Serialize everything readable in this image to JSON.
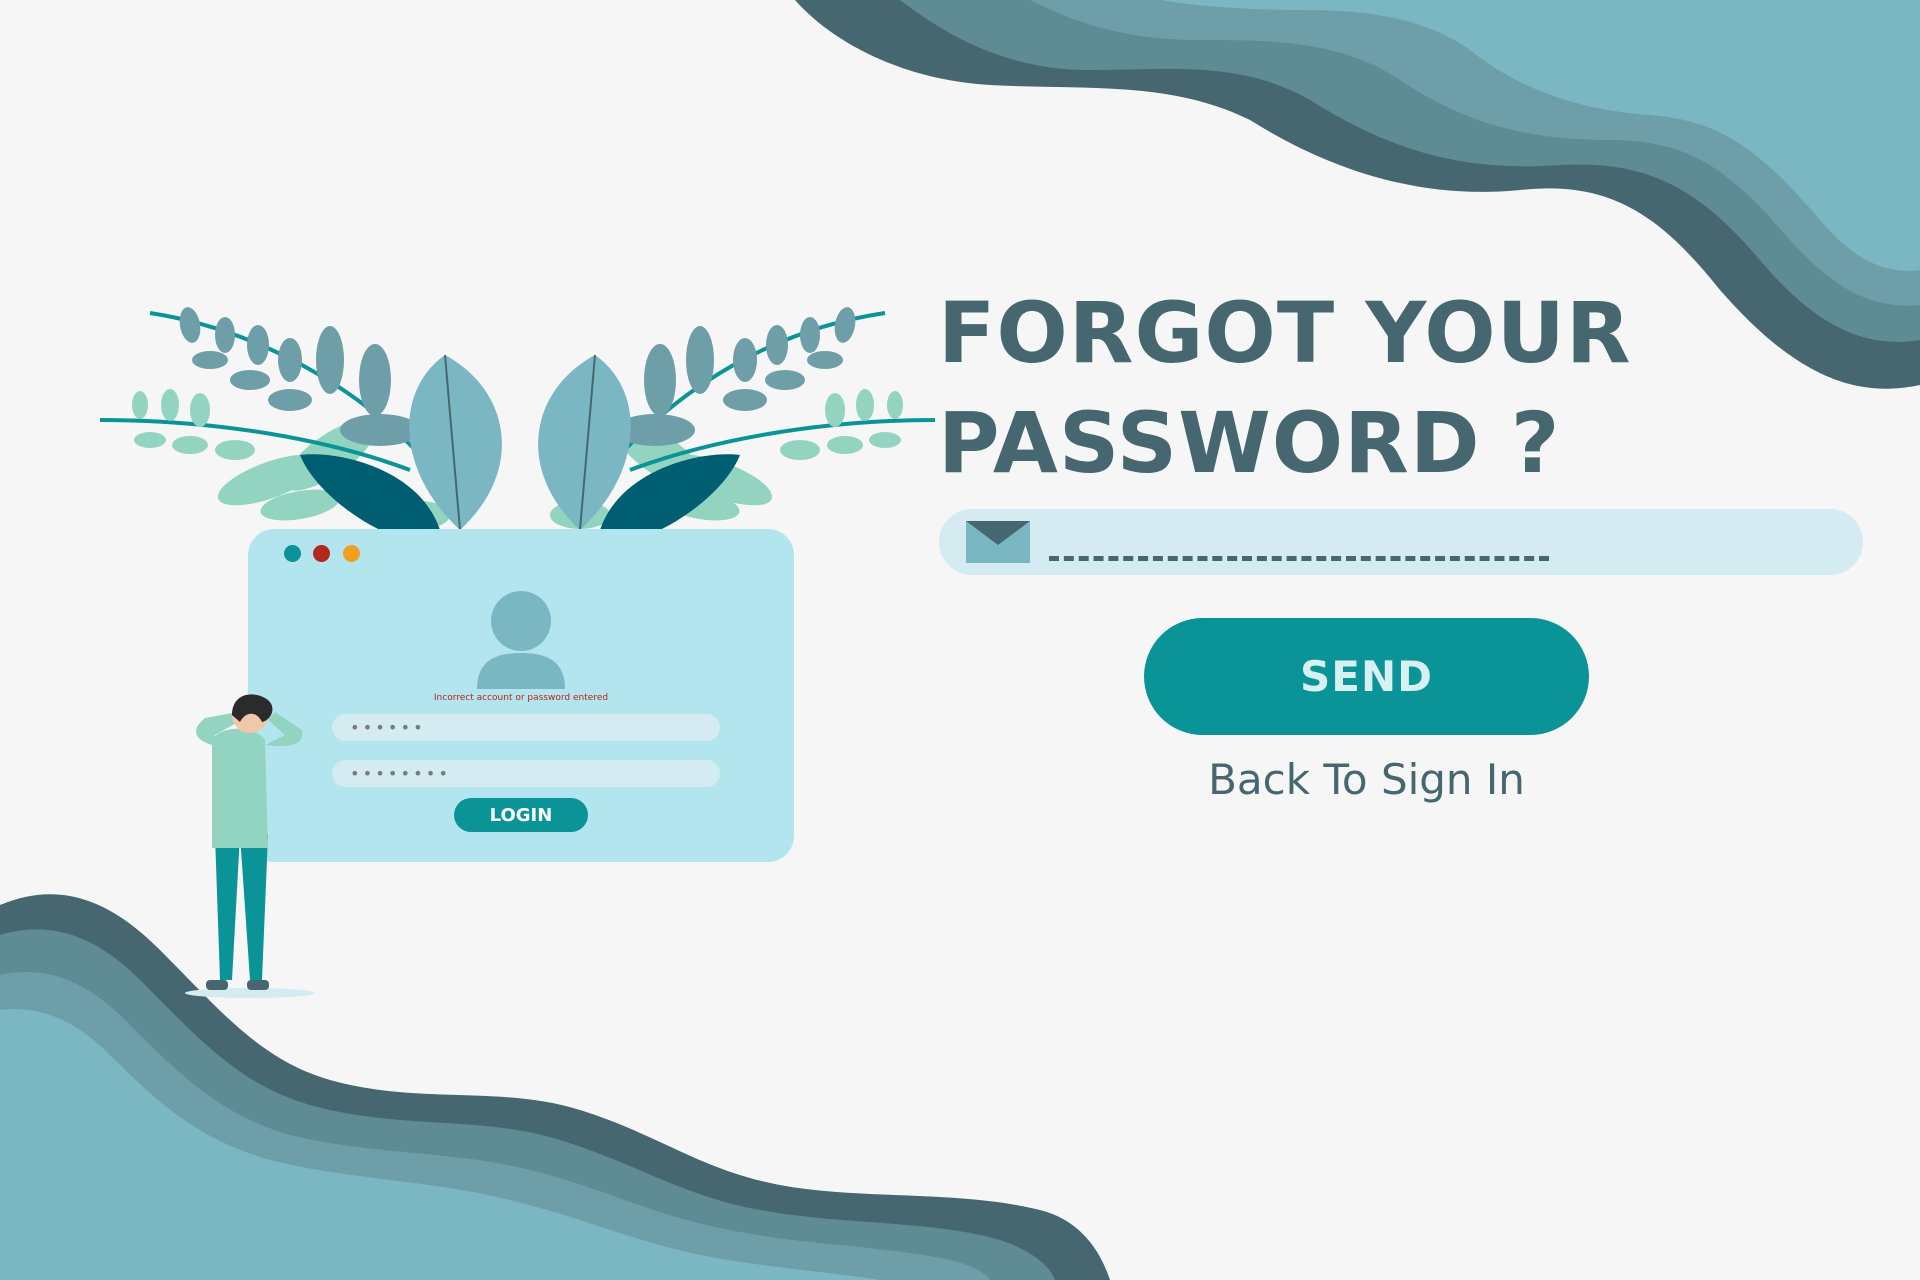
{
  "title": {
    "line1": "FORGOT YOUR",
    "line2": "PASSWORD ?"
  },
  "email_field": {
    "icon": "envelope-icon",
    "value": ""
  },
  "send_button": {
    "label": "SEND"
  },
  "back_link": {
    "label": "Back To Sign In"
  },
  "illustration": {
    "error_message": "Incorrect account or password entered",
    "username_mask": "••••••",
    "password_mask": "••••••••",
    "login_label": "LOGIN",
    "avatar_icon": "user-avatar-icon",
    "window_dots": [
      "#0b9497",
      "#b3271d",
      "#f0a01e"
    ]
  },
  "colors": {
    "background": "#f6f6f6",
    "title": "#476770",
    "accent": "#0b9497",
    "field_bg": "#d3ebf1",
    "card_bg": "#b3e5ef",
    "wave_dark": "#476770",
    "wave_mid": "#5f8c94",
    "wave_light": "#6e9fa8",
    "wave_lightest": "#7ab7c3"
  }
}
